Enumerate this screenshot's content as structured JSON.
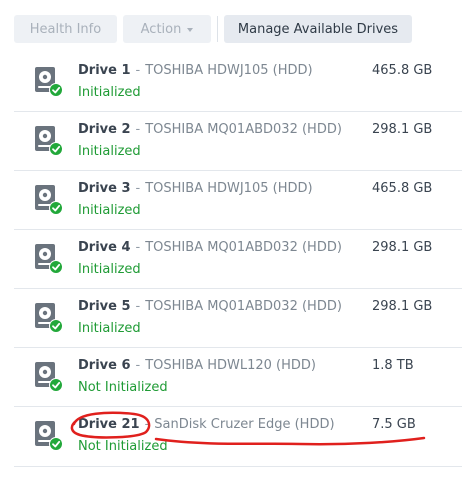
{
  "toolbar": {
    "health_info_label": "Health Info",
    "action_label": "Action",
    "manage_drives_label": "Manage Available Drives"
  },
  "colors": {
    "status_green": "#1f9b35",
    "annotation_red": "#e0201d",
    "icon_gray": "#6a737d"
  },
  "drives": [
    {
      "name": "Drive 1",
      "model": "TOSHIBA HDWJ105 (HDD)",
      "size": "465.8 GB",
      "status": "Initialized",
      "icon": "hdd-icon"
    },
    {
      "name": "Drive 2",
      "model": "TOSHIBA MQ01ABD032 (HDD)",
      "size": "298.1 GB",
      "status": "Initialized",
      "icon": "hdd-icon"
    },
    {
      "name": "Drive 3",
      "model": "TOSHIBA HDWJ105 (HDD)",
      "size": "465.8 GB",
      "status": "Initialized",
      "icon": "hdd-icon"
    },
    {
      "name": "Drive 4",
      "model": "TOSHIBA MQ01ABD032 (HDD)",
      "size": "298.1 GB",
      "status": "Initialized",
      "icon": "hdd-icon"
    },
    {
      "name": "Drive 5",
      "model": "TOSHIBA MQ01ABD032 (HDD)",
      "size": "298.1 GB",
      "status": "Initialized",
      "icon": "hdd-icon"
    },
    {
      "name": "Drive 6",
      "model": "TOSHIBA HDWL120 (HDD)",
      "size": "1.8 TB",
      "status": "Not Initialized",
      "icon": "hdd-icon"
    },
    {
      "name": "Drive 21",
      "model": "SanDisk Cruzer Edge (HDD)",
      "size": "7.5 GB",
      "status": "Not Initialized",
      "icon": "hdd-icon"
    }
  ]
}
